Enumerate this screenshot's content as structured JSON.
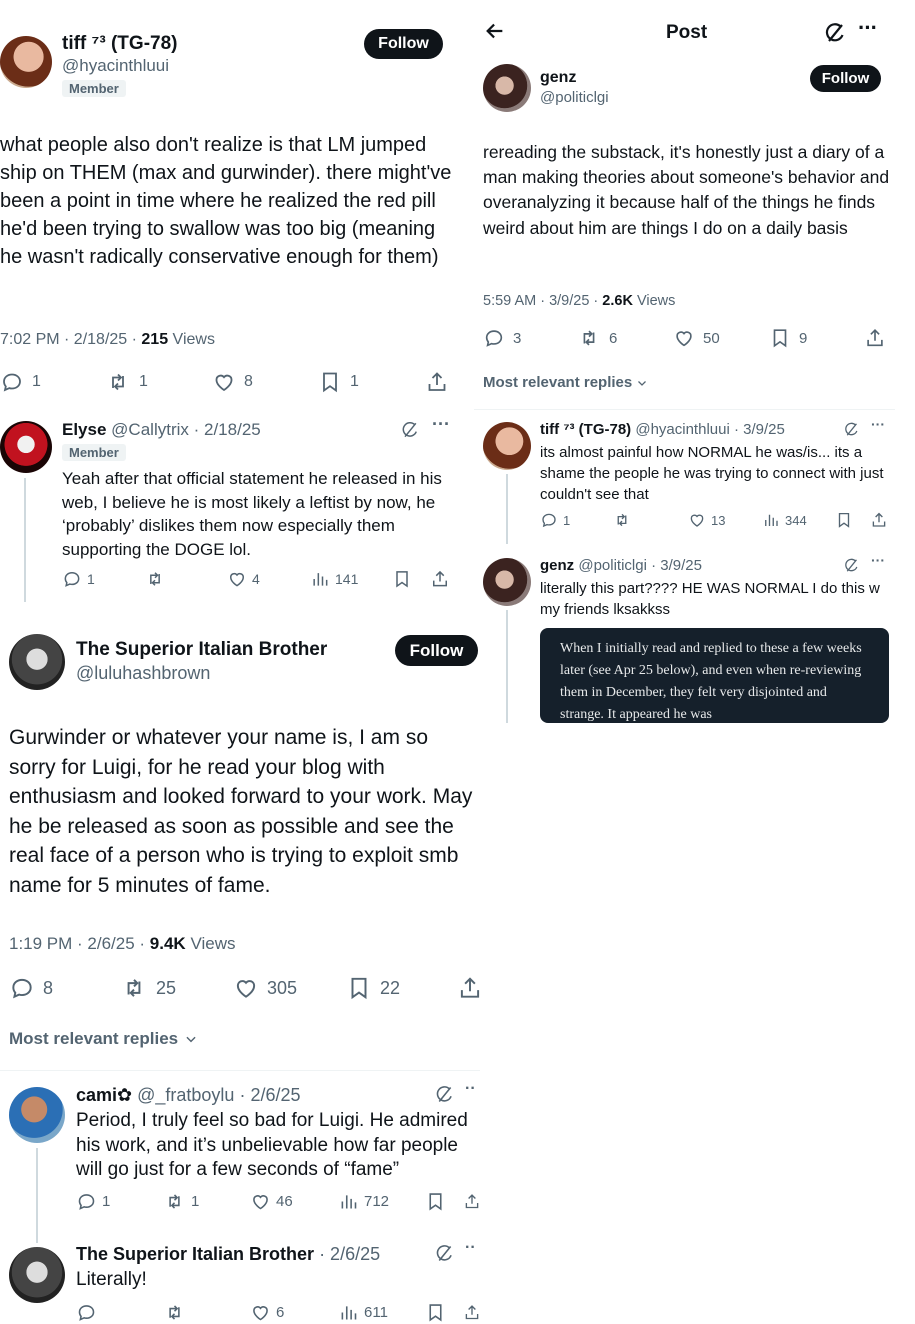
{
  "left_top": {
    "author": {
      "name": "tiff ⁷³ (TG-78)",
      "handle": "@hyacinthluui",
      "badge": "Member"
    },
    "follow_label": "Follow",
    "text": "what people also don't realize is that LM jumped ship on THEM (max and gurwinder). there might've been a point in time where he realized the red pill he'd been trying to swallow was too big (meaning he wasn't radically conservative enough for them)",
    "time": "7:02 PM · 2/18/25 · ",
    "views_count": "215",
    "views_label": " Views",
    "replies": "1",
    "reposts": "1",
    "likes": "8",
    "bookmarks": "1"
  },
  "left_reply": {
    "author": {
      "name": "Elyse",
      "handle": "@Callytrix",
      "date": "· 2/18/25",
      "badge": "Member"
    },
    "text": "Yeah after that official statement he released in his web, I believe he is most likely a leftist by now, he ‘probably’ dislikes them now especially them supporting the DOGE lol.",
    "replies": "1",
    "reposts": "",
    "likes": "4",
    "views": "141"
  },
  "left_main": {
    "author": {
      "name": "The Superior Italian Brother",
      "handle": "@luluhashbrown"
    },
    "follow_label": "Follow",
    "text": "Gurwinder or whatever your name is, I am so sorry for Luigi, for he read your blog with enthusiasm and looked forward to your work. May he be released as soon as possible and see the real face of a person who is trying to exploit smb name for 5 minutes of fame.",
    "time": "1:19 PM · 2/6/25 · ",
    "views_count": "9.4K",
    "views_label": " Views",
    "replies": "8",
    "reposts": "25",
    "likes": "305",
    "bookmarks": "22",
    "most_relevant": "Most relevant replies"
  },
  "left_replies": [
    {
      "name": "cami✿",
      "handle": "@_fratboylu",
      "date": "· 2/6/25",
      "text": "Period, I truly feel so bad for Luigi. He admired his work, and it’s unbelievable how far people will go just for a few seconds of “fame”",
      "replies": "1",
      "reposts": "1",
      "likes": "46",
      "views": "712"
    },
    {
      "name": "The Superior Italian Brother",
      "handle": "",
      "date": "· 2/6/25",
      "text": "Literally!",
      "replies": "",
      "reposts": "",
      "likes": "6",
      "views": "611"
    }
  ],
  "right": {
    "header_title": "Post",
    "author": {
      "name": "genz",
      "handle": "@politiclgi"
    },
    "follow_label": "Follow",
    "text": "rereading the substack, it's honestly just a diary of a man making theories about someone's behavior and overanalyzing it because half of the things he finds weird about him are things I do on a daily basis",
    "time": "5:59 AM · 3/9/25 · ",
    "views_count": "2.6K",
    "views_label": " Views",
    "replies": "3",
    "reposts": "6",
    "likes": "50",
    "bookmarks": "9",
    "most_relevant": "Most relevant replies",
    "replies_list": [
      {
        "name": "tiff ⁷³ (TG-78)",
        "handle": "@hyacinthluui",
        "date": "· 3/9/25",
        "text": "its almost painful how NORMAL he was/is... its a shame the people he was trying to connect with just couldn't see that",
        "replies": "1",
        "reposts": "",
        "likes": "13",
        "views": "344"
      },
      {
        "name": "genz",
        "handle": "@politiclgi",
        "date": "· 3/9/25",
        "text": "literally this part???? HE WAS NORMAL I do this w my friends lksakkss",
        "quote": "When I initially read and replied to these a few weeks later (see Apr 25 below), and even when re-reviewing them in December, they felt very disjointed and strange. It appeared he was"
      }
    ]
  }
}
